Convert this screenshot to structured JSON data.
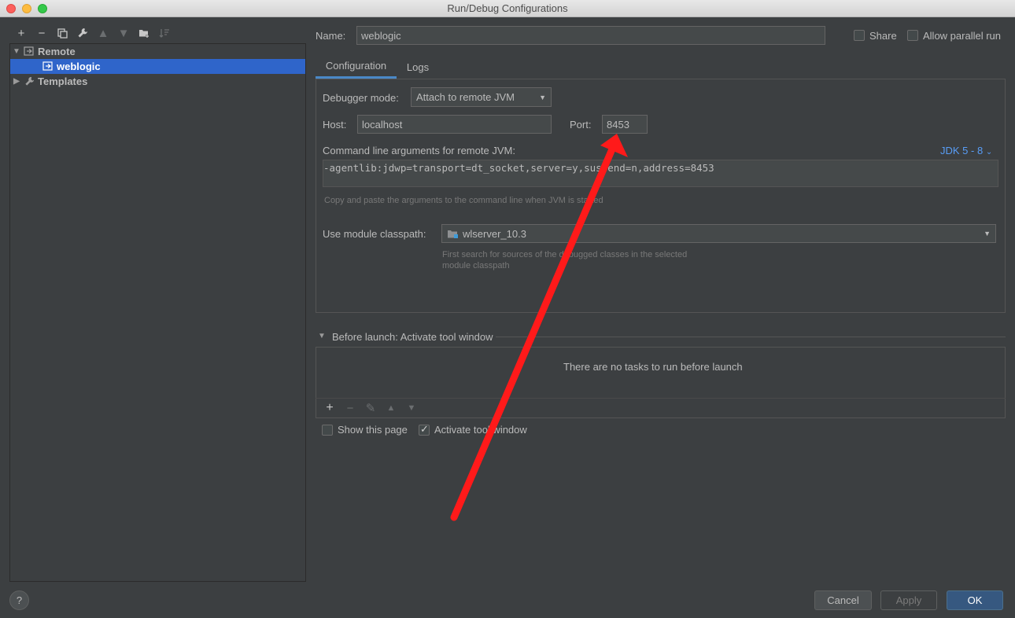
{
  "window": {
    "title": "Run/Debug Configurations"
  },
  "toolbar": {
    "icons": [
      "plus-icon",
      "minus-icon",
      "copy-icon",
      "wrench-icon",
      "arrow-up-icon",
      "arrow-down-icon",
      "folder-add-icon",
      "sort-icon"
    ]
  },
  "tree": {
    "remote_label": "Remote",
    "weblogic_label": "weblogic",
    "templates_label": "Templates"
  },
  "header": {
    "name_label": "Name:",
    "name_value": "weblogic",
    "share_label": "Share",
    "parallel_label": "Allow parallel run"
  },
  "tabs": [
    {
      "label": "Configuration",
      "active": true
    },
    {
      "label": "Logs",
      "active": false
    }
  ],
  "config": {
    "debugger_mode_label": "Debugger mode:",
    "debugger_mode_value": "Attach to remote JVM",
    "host_label": "Host:",
    "host_value": "localhost",
    "port_label": "Port:",
    "port_value": "8453",
    "cmd_label": "Command line arguments for remote JVM:",
    "jdk_link": "JDK 5 - 8",
    "cmd_value": "-agentlib:jdwp=transport=dt_socket,server=y,suspend=n,address=8453",
    "cmd_hint": "Copy and paste the arguments to the command line when JVM is started",
    "module_label": "Use module classpath:",
    "module_value": "wlserver_10.3",
    "module_hint_line1": "First search for sources of the debugged classes in the selected",
    "module_hint_line2": "module classpath"
  },
  "before_launch": {
    "title": "Before launch: Activate tool window",
    "empty_text": "There are no tasks to run before launch",
    "show_page_label": "Show this page",
    "activate_label": "Activate tool window",
    "show_page_checked": false,
    "activate_checked": true
  },
  "buttons": {
    "cancel": "Cancel",
    "apply": "Apply",
    "ok": "OK",
    "help": "?"
  },
  "colors": {
    "accent": "#2f65ca",
    "ok_button": "#365880",
    "link": "#589df6",
    "annotation_arrow": "#ff1a1a"
  }
}
